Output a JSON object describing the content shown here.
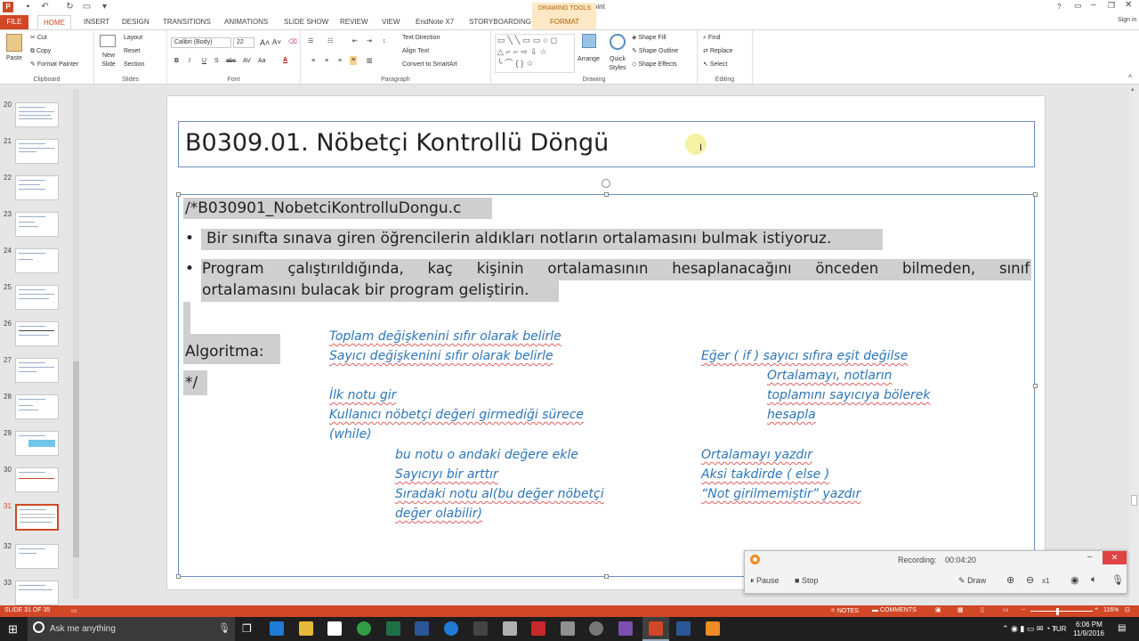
{
  "titlebar": {
    "document": "B02.pptx - PowerPoint",
    "help": "?",
    "signin": "Sign in"
  },
  "tabs": {
    "file": "FILE",
    "home": "HOME",
    "insert": "INSERT",
    "design": "DESIGN",
    "transitions": "TRANSITIONS",
    "animations": "ANIMATIONS",
    "slideshow": "SLIDE SHOW",
    "review": "REVIEW",
    "view": "VIEW",
    "endnote": "EndNote X7",
    "storyboarding": "STORYBOARDING",
    "drawing_tools": "DRAWING TOOLS",
    "format": "FORMAT"
  },
  "ribbon": {
    "clipboard": {
      "label": "Clipboard",
      "paste": "Paste",
      "cut": "Cut",
      "copy": "Copy",
      "format_painter": "Format Painter"
    },
    "slides": {
      "label": "Slides",
      "new_slide": "New Slide",
      "layout": "Layout",
      "reset": "Reset",
      "section": "Section"
    },
    "font": {
      "label": "Font",
      "family": "Calibri (Body)",
      "size": "22"
    },
    "paragraph": {
      "label": "Paragraph",
      "text_direction": "Text Direction",
      "align_text": "Align Text",
      "smartart": "Convert to SmartArt"
    },
    "drawing": {
      "label": "Drawing",
      "arrange": "Arrange",
      "quick_styles": "Quick Styles",
      "shape_fill": "Shape Fill",
      "shape_outline": "Shape Outline",
      "shape_effects": "Shape Effects"
    },
    "editing": {
      "label": "Editing",
      "find": "Find",
      "replace": "Replace",
      "select": "Select"
    }
  },
  "thumbnails": [
    "20",
    "21",
    "22",
    "23",
    "24",
    "25",
    "26",
    "27",
    "28",
    "29",
    "30",
    "31",
    "32",
    "33"
  ],
  "slide": {
    "title": "B0309.01. Nöbetçi Kontrollü Döngü",
    "comment_start": "/*B030901_NobetciKontrolluDongu.c",
    "bullet1": "Bir sınıfta sınava giren öğrencilerin aldıkları notların ortalamasını bulmak istiyoruz.",
    "bullet2a": "Program  çalıştırıldığında,  kaç  kişinin  ortalamasının  hesaplanacağını  önceden  bilmeden,  sınıf",
    "bullet2b": "ortalamasını bulacak bir program geliştirin.",
    "algoritma": "Algoritma:",
    "comment_end": "*/",
    "algo_left": [
      "Toplam değişkenini sıfır olarak belirle",
      "Sayıcı değişkenini sıfır olarak belirle",
      "İlk notu gir",
      "Kullanıcı nöbetçi değeri girmediği sürece",
      "(while)"
    ],
    "algo_loop": [
      "bu notu o andaki değere ekle",
      "Sayıcıyı bir arttır",
      "Sıradaki notu al(bu değer nöbetçi",
      "değer olabilir)"
    ],
    "algo_right": [
      "Eğer ( if ) sayıcı sıfıra eşit değilse",
      "Ortalamayı, notların",
      "toplamını sayıcıya bölerek",
      "hesapla",
      "Ortalamayı yazdır",
      "Aksi takdirde ( else )",
      "“Not girilmemiştir” yazdır"
    ]
  },
  "recorder": {
    "status": "Recording:",
    "time": "00:04:20",
    "pause": "Pause",
    "stop": "Stop",
    "draw": "Draw",
    "zoom": "x1"
  },
  "statusbar": {
    "slide": "SLIDE 31 OF 35",
    "notes": "NOTES",
    "comments": "COMMENTS",
    "zoom": "116%"
  },
  "taskbar": {
    "search": "Ask me anything",
    "time": "6:06 PM",
    "date": "11/9/2016",
    "lang": "TUR"
  }
}
